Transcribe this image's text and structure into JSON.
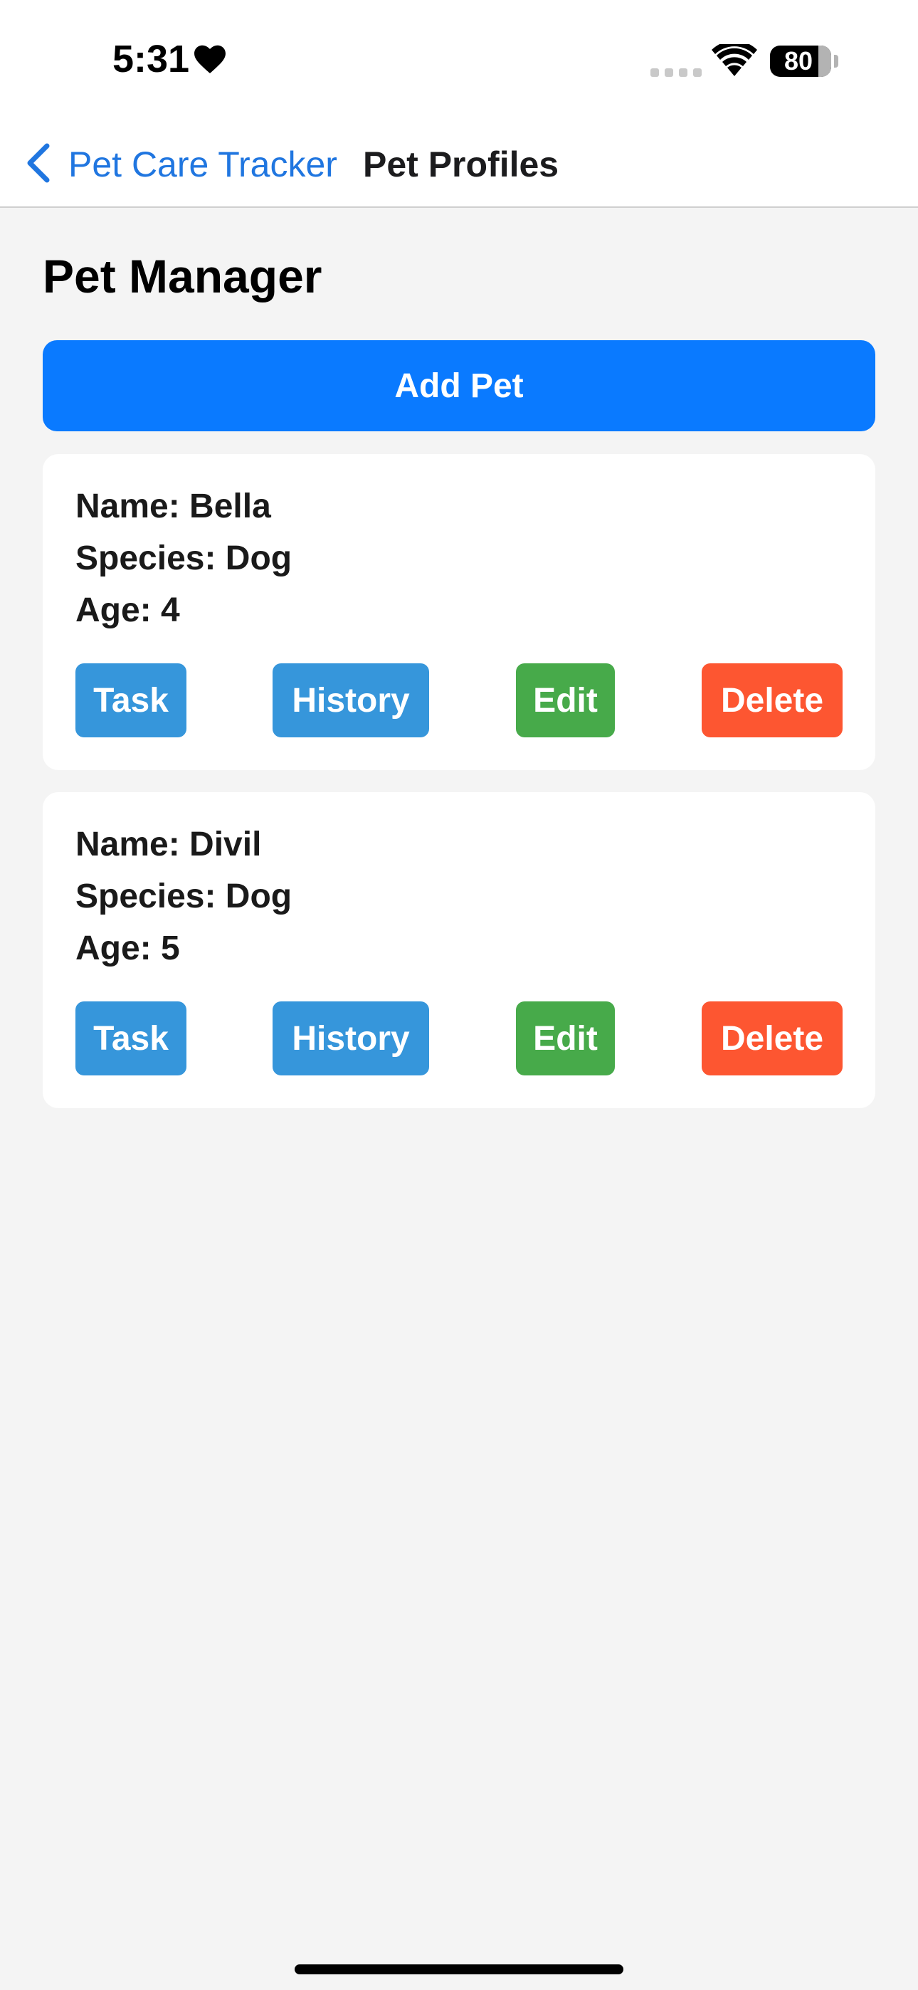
{
  "status_bar": {
    "time": "5:31",
    "battery_percent": "80",
    "icons": [
      "heart-icon",
      "signal-icon",
      "wifi-icon",
      "battery-icon"
    ]
  },
  "nav": {
    "back_label": "Pet Care Tracker",
    "title": "Pet Profiles",
    "icons": [
      "chevron-left-icon"
    ]
  },
  "page": {
    "title": "Pet Manager",
    "add_button_label": "Add Pet"
  },
  "pets": [
    {
      "name_line": "Name: Bella",
      "species_line": "Species: Dog",
      "age_line": "Age: 4",
      "buttons": {
        "task": "Task",
        "history": "History",
        "edit": "Edit",
        "delete": "Delete"
      }
    },
    {
      "name_line": "Name: Divil",
      "species_line": "Species: Dog",
      "age_line": "Age: 5",
      "buttons": {
        "task": "Task",
        "history": "History",
        "edit": "Edit",
        "delete": "Delete"
      }
    }
  ],
  "colors": {
    "accent": "#0a7aff",
    "back_link": "#2076e0",
    "task_history": "#3696db",
    "edit": "#47aa4a",
    "delete": "#fd5631",
    "background": "#f4f4f4"
  }
}
